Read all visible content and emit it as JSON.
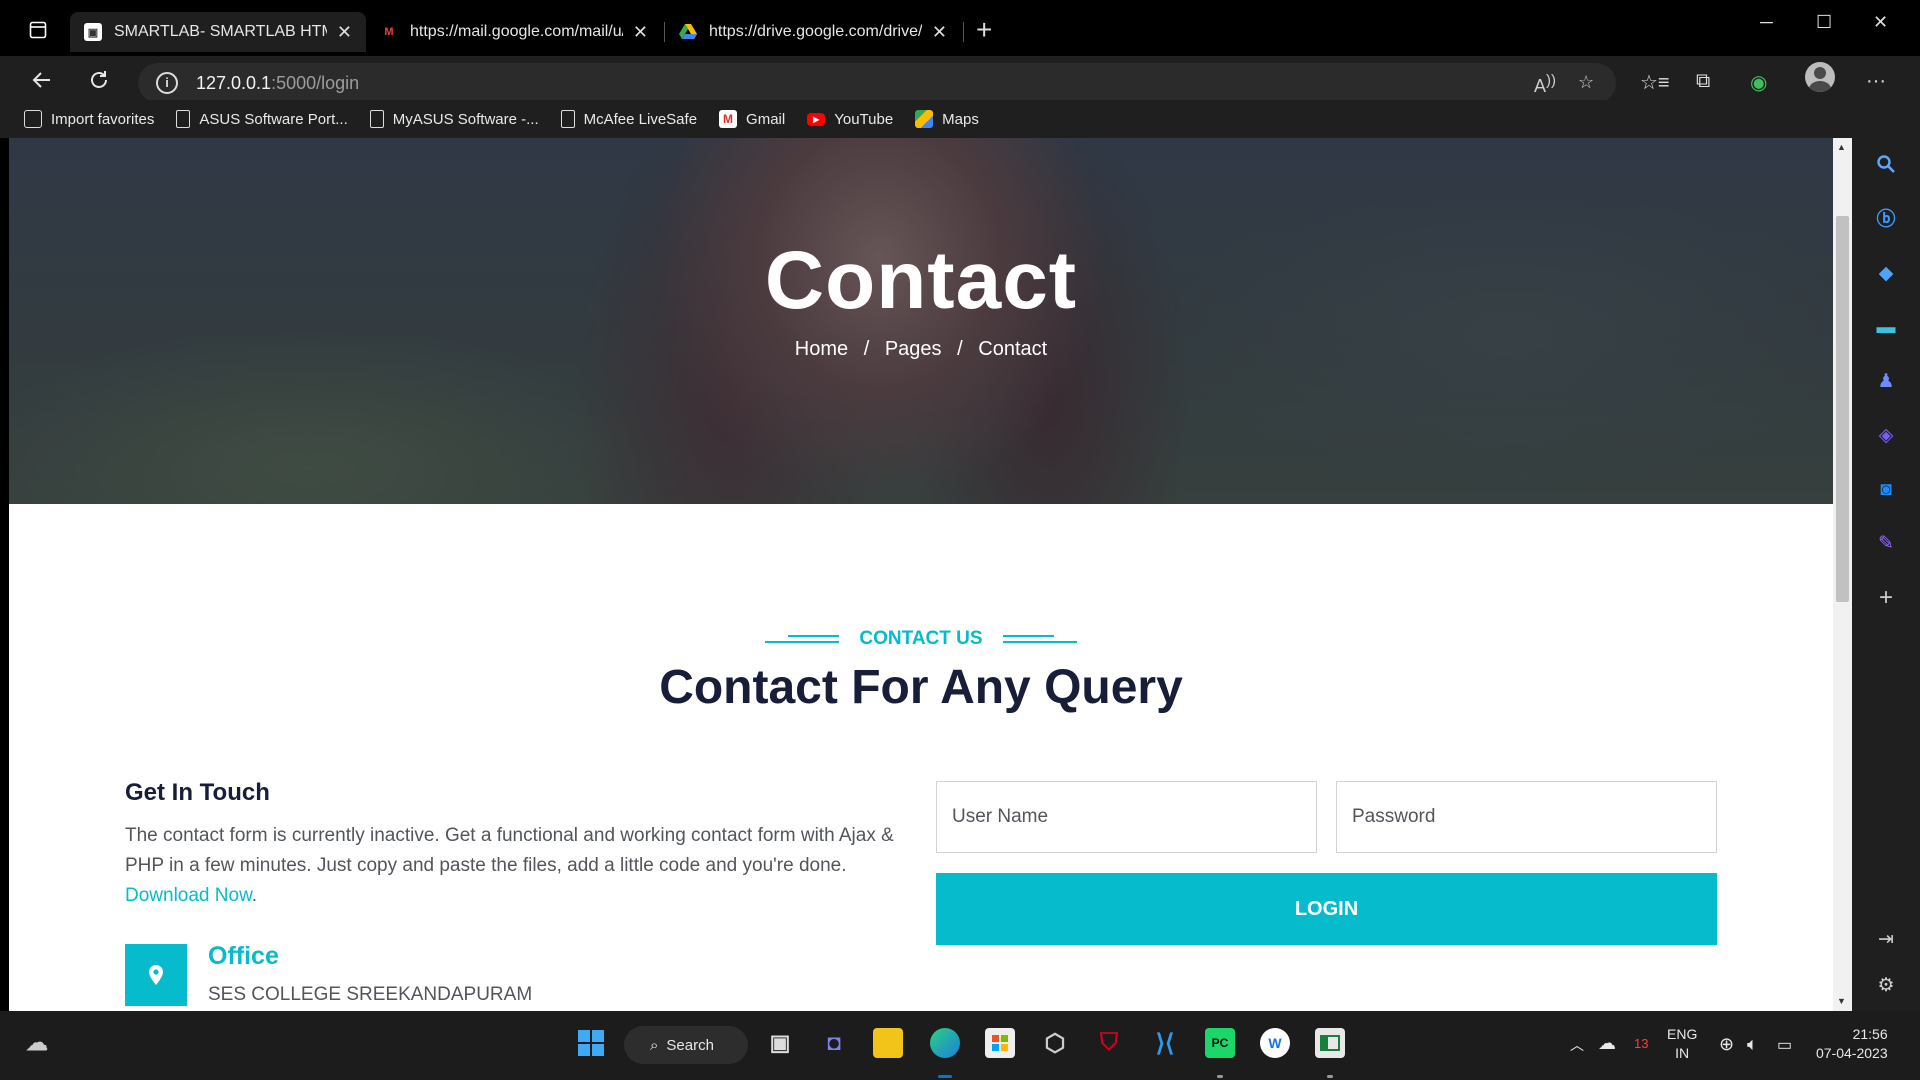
{
  "browser": {
    "tabs": [
      {
        "title": "SMARTLAB- SMARTLAB HTML Te",
        "active": true
      },
      {
        "title": "https://mail.google.com/mail/u/",
        "active": false
      },
      {
        "title": "https://drive.google.com/drive/m",
        "active": false
      }
    ],
    "url_host": "127.0.0.1",
    "url_path": ":5000/login",
    "bookmarks": [
      "Import favorites",
      "ASUS Software Port...",
      "MyASUS Software -...",
      "McAfee LiveSafe",
      "Gmail",
      "YouTube",
      "Maps"
    ]
  },
  "hero": {
    "title": "Contact",
    "breadcrumb": [
      "Home",
      "Pages",
      "Contact"
    ],
    "separator": "/"
  },
  "section": {
    "tag": "CONTACT US",
    "heading": "Contact For Any Query"
  },
  "get_in_touch": {
    "title": "Get In Touch",
    "text": "The contact form is currently inactive. Get a functional and working contact form with Ajax & PHP in a few minutes. Just copy and paste the files, add a little code and you're done.",
    "link": "Download Now",
    "after_link": "."
  },
  "office": {
    "title": "Office",
    "address": "SES COLLEGE SREEKANDAPURAM"
  },
  "form": {
    "username_placeholder": "User Name",
    "password_placeholder": "Password",
    "login_label": "LOGIN"
  },
  "taskbar": {
    "search_label": "Search",
    "notification_count": "13",
    "language": "ENG",
    "region": "IN",
    "time": "21:56",
    "date": "07-04-2023"
  },
  "colors": {
    "accent": "#06bbcc",
    "heading": "#181d38",
    "text": "#52565b"
  }
}
